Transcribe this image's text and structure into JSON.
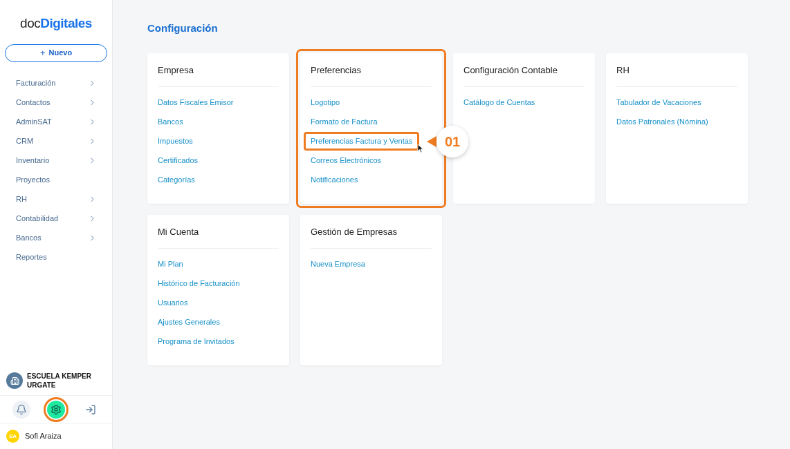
{
  "logo": {
    "prefix": "doc",
    "suffix": "Digitales"
  },
  "new_button": {
    "icon": "+",
    "label": "Nuevo"
  },
  "sidebar": {
    "items": [
      {
        "label": "Facturación",
        "expandable": true
      },
      {
        "label": "Contactos",
        "expandable": true
      },
      {
        "label": "AdminSAT",
        "expandable": true
      },
      {
        "label": "CRM",
        "expandable": true
      },
      {
        "label": "Inventario",
        "expandable": true
      },
      {
        "label": "Proyectos",
        "expandable": false
      },
      {
        "label": "RH",
        "expandable": true
      },
      {
        "label": "Contabilidad",
        "expandable": true
      },
      {
        "label": "Bancos",
        "expandable": true
      },
      {
        "label": "Reportes",
        "expandable": false
      }
    ]
  },
  "company": {
    "name": "ESCUELA KEMPER URGATE"
  },
  "footer_actions": [
    {
      "kind": "bell",
      "selected": false
    },
    {
      "kind": "gear",
      "selected": true
    },
    {
      "kind": "logout",
      "selected": false
    }
  ],
  "user": {
    "initials": "SA",
    "name": "Sofi Araiza"
  },
  "page_title": "Configuración",
  "cards": [
    {
      "title": "Empresa",
      "highlighted": false,
      "links": [
        {
          "label": "Datos Fiscales Emisor",
          "highlighted": false
        },
        {
          "label": "Bancos",
          "highlighted": false
        },
        {
          "label": "Impuestos",
          "highlighted": false
        },
        {
          "label": "Certificados",
          "highlighted": false
        },
        {
          "label": "Categorías",
          "highlighted": false
        }
      ]
    },
    {
      "title": "Preferencias",
      "highlighted": true,
      "links": [
        {
          "label": "Logotipo",
          "highlighted": false
        },
        {
          "label": "Formato de Factura",
          "highlighted": false
        },
        {
          "label": "Preferencias Factura y Ventas",
          "highlighted": true,
          "callout": "01"
        },
        {
          "label": "Correos Electrónicos",
          "highlighted": false
        },
        {
          "label": "Notificaciones",
          "highlighted": false
        }
      ]
    },
    {
      "title": "Configuración Contable",
      "highlighted": false,
      "links": [
        {
          "label": "Catálogo de Cuentas",
          "highlighted": false
        }
      ]
    },
    {
      "title": "RH",
      "highlighted": false,
      "links": [
        {
          "label": "Tabulador de Vacaciones",
          "highlighted": false
        },
        {
          "label": "Datos Patronales (Nómina)",
          "highlighted": false
        }
      ]
    },
    {
      "title": "Mi Cuenta",
      "highlighted": false,
      "links": [
        {
          "label": "Mi Plan",
          "highlighted": false
        },
        {
          "label": "Histórico de Facturación",
          "highlighted": false
        },
        {
          "label": "Usuarios",
          "highlighted": false
        },
        {
          "label": "Ajustes Generales",
          "highlighted": false
        },
        {
          "label": "Programa de Invitados",
          "highlighted": false
        }
      ]
    },
    {
      "title": "Gestión de Empresas",
      "highlighted": false,
      "links": [
        {
          "label": "Nueva Empresa",
          "highlighted": false
        }
      ]
    }
  ]
}
